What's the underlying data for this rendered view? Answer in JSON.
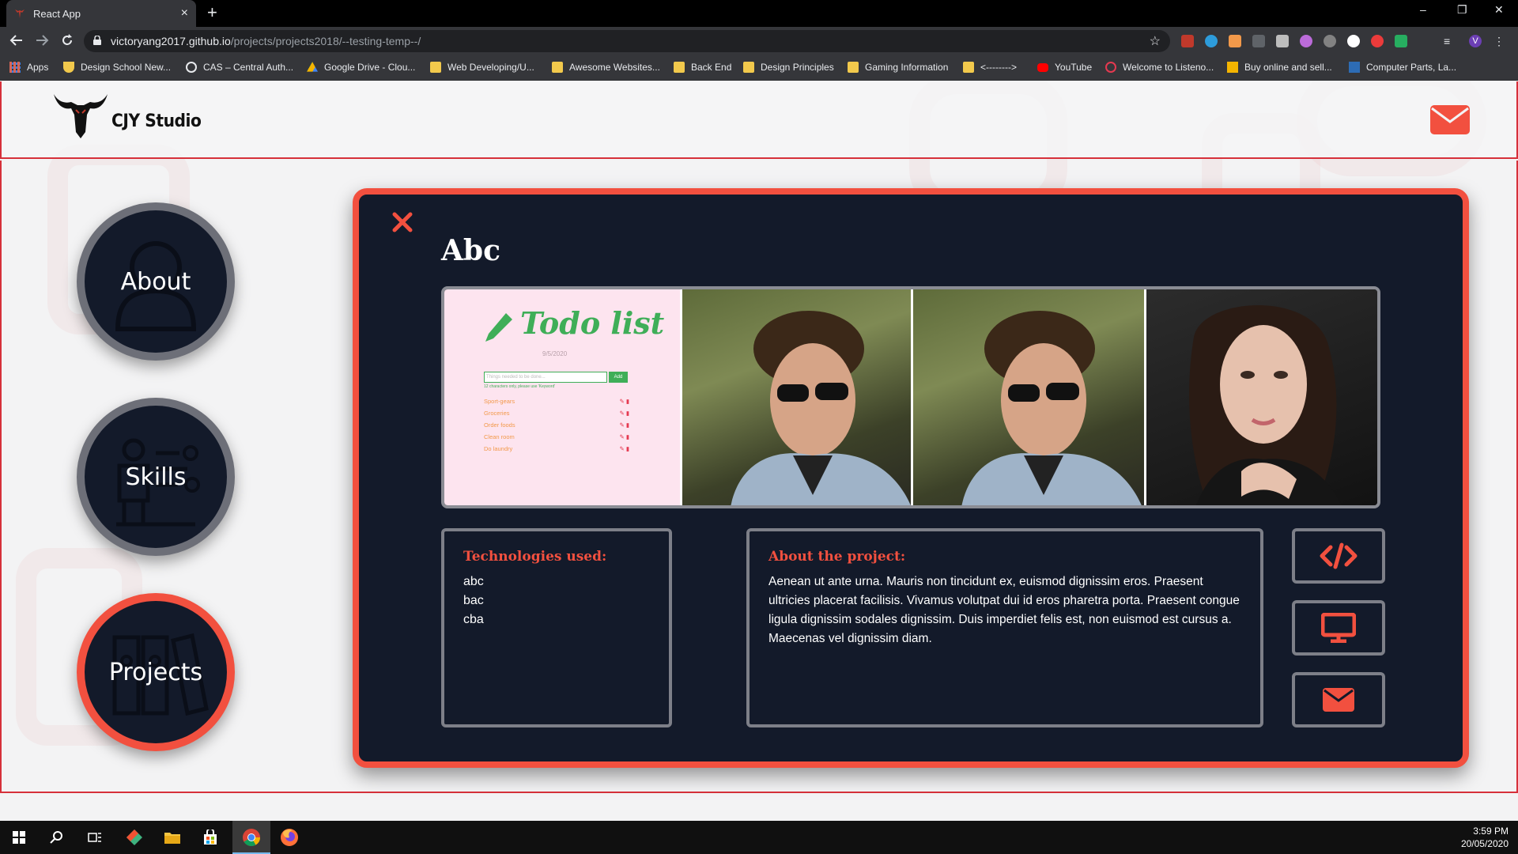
{
  "browser": {
    "tab_title": "React App",
    "tab_close": "×",
    "new_tab": "+",
    "url_host": "victoryang2017.github.io",
    "url_path": "/projects/projects2018/--testing-temp--/",
    "window_controls": [
      "–",
      "❐",
      "✕"
    ],
    "bookmarks": [
      {
        "label": "Apps",
        "icon": "apps-grid-icon"
      },
      {
        "label": "Design School New...",
        "icon": "shield-icon"
      },
      {
        "label": "CAS – Central Auth...",
        "icon": "cas-icon"
      },
      {
        "label": "Google Drive - Clou...",
        "icon": "google-drive-icon"
      },
      {
        "label": "Web Developing/U...",
        "icon": "folder-icon"
      },
      {
        "label": "Awesome Websites...",
        "icon": "folder-icon"
      },
      {
        "label": "Back End",
        "icon": "folder-icon"
      },
      {
        "label": "Design Principles",
        "icon": "folder-icon"
      },
      {
        "label": "Gaming Information",
        "icon": "folder-icon"
      },
      {
        "label": "<-------->",
        "icon": "folder-icon"
      },
      {
        "label": "YouTube",
        "icon": "youtube-icon"
      },
      {
        "label": "Welcome to Listeno...",
        "icon": "listeno-icon"
      },
      {
        "label": "Buy online and sell...",
        "icon": "shop-icon"
      },
      {
        "label": "Computer Parts, La...",
        "icon": "pc-parts-icon"
      }
    ]
  },
  "site": {
    "brand": "CJY Studio",
    "nav": [
      {
        "label": "About",
        "icon": "person-icon",
        "active": false
      },
      {
        "label": "Skills",
        "icon": "presenter-icon",
        "active": false
      },
      {
        "label": "Projects",
        "icon": "binders-icon",
        "active": true
      }
    ],
    "project": {
      "title": "Abc",
      "gallery": [
        {
          "kind": "todo-app-screenshot",
          "title": "Todo list",
          "date": "9/5/2020",
          "placeholder": "Things needed to be done...",
          "add_label": "Add",
          "hint": "12 characters only, please use 'Keyword'",
          "items": [
            "Sport-gears",
            "Groceries",
            "Order foods",
            "Clean room",
            "Do laundry"
          ]
        },
        {
          "kind": "portrait-photo",
          "subject": "man-with-sunglasses"
        },
        {
          "kind": "portrait-photo",
          "subject": "man-with-sunglasses"
        },
        {
          "kind": "portrait-photo",
          "subject": "woman-dark-hair"
        }
      ],
      "technologies_heading": "Technologies used:",
      "technologies": [
        "abc",
        "bac",
        "cba"
      ],
      "about_heading": "About the project:",
      "about_text": "Aenean ut ante urna. Mauris non tincidunt ex, euismod dignissim eros. Praesent ultricies placerat facilisis. Vivamus volutpat dui id eros pharetra porta. Praesent congue ligula dignissim sodales dignissim. Duis imperdiet felis est, non euismod est cursus a. Maecenas vel dignissim diam.",
      "actions": [
        {
          "icon": "code-icon"
        },
        {
          "icon": "monitor-icon"
        },
        {
          "icon": "envelope-icon"
        }
      ]
    },
    "colors": {
      "accent": "#f2503f",
      "panel": "#131a2a",
      "header_line": "#d6303a"
    }
  },
  "taskbar": {
    "time": "3:59 PM",
    "date": "20/05/2020",
    "apps": [
      "windows-start-icon",
      "search-icon",
      "task-view-icon",
      "git-icon",
      "file-explorer-icon",
      "store-icon",
      "chrome-icon",
      "firefox-icon"
    ]
  }
}
